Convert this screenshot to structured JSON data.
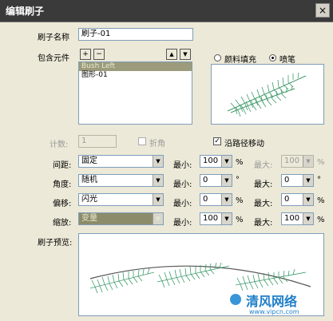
{
  "window": {
    "title": "编辑刷子",
    "close_glyph": "×"
  },
  "form": {
    "brush_name_label": "刷子名称",
    "brush_name_value": "刷子-01",
    "contains_label": "包含元件",
    "elements": [
      "Bush Left",
      "图形-01"
    ],
    "add_glyph": "+",
    "remove_glyph": "−",
    "up_glyph": "▲",
    "down_glyph": "▼",
    "fill_radio_label": "颜料填充",
    "spray_radio_label": "喷笔",
    "count_label": "计数:",
    "count_value": "1",
    "fold_label": "折角",
    "follow_path_label": "沿路径移动",
    "follow_path_checked": true,
    "preview_label": "刷子预览:",
    "rows": [
      {
        "label": "间距:",
        "combo": "固定",
        "min_label": "最小:",
        "min": "100",
        "min_unit": "%",
        "max_label": "最大:",
        "max": "100",
        "max_unit": "%",
        "max_disabled": true
      },
      {
        "label": "角度:",
        "combo": "随机",
        "min_label": "最小:",
        "min": "0",
        "min_unit": "°",
        "max_label": "最大:",
        "max": "0",
        "max_unit": "°",
        "max_disabled": false
      },
      {
        "label": "偏移:",
        "combo": "闪光",
        "min_label": "最小:",
        "min": "0",
        "min_unit": "%",
        "max_label": "最大:",
        "max": "0",
        "max_unit": "%",
        "max_disabled": false
      },
      {
        "label": "缩放:",
        "combo": "变量",
        "min_label": "最小:",
        "min": "100",
        "min_unit": "%",
        "max_label": "最大:",
        "max": "100",
        "max_unit": "%",
        "max_disabled": false
      }
    ]
  },
  "watermark": {
    "brand": "清风网络",
    "url": "www.vipcn.com"
  },
  "colors": {
    "titlebar": "#3a3a3a",
    "dialog_bg": "#ece9d8",
    "leaf_green": "#3e9b6a"
  }
}
